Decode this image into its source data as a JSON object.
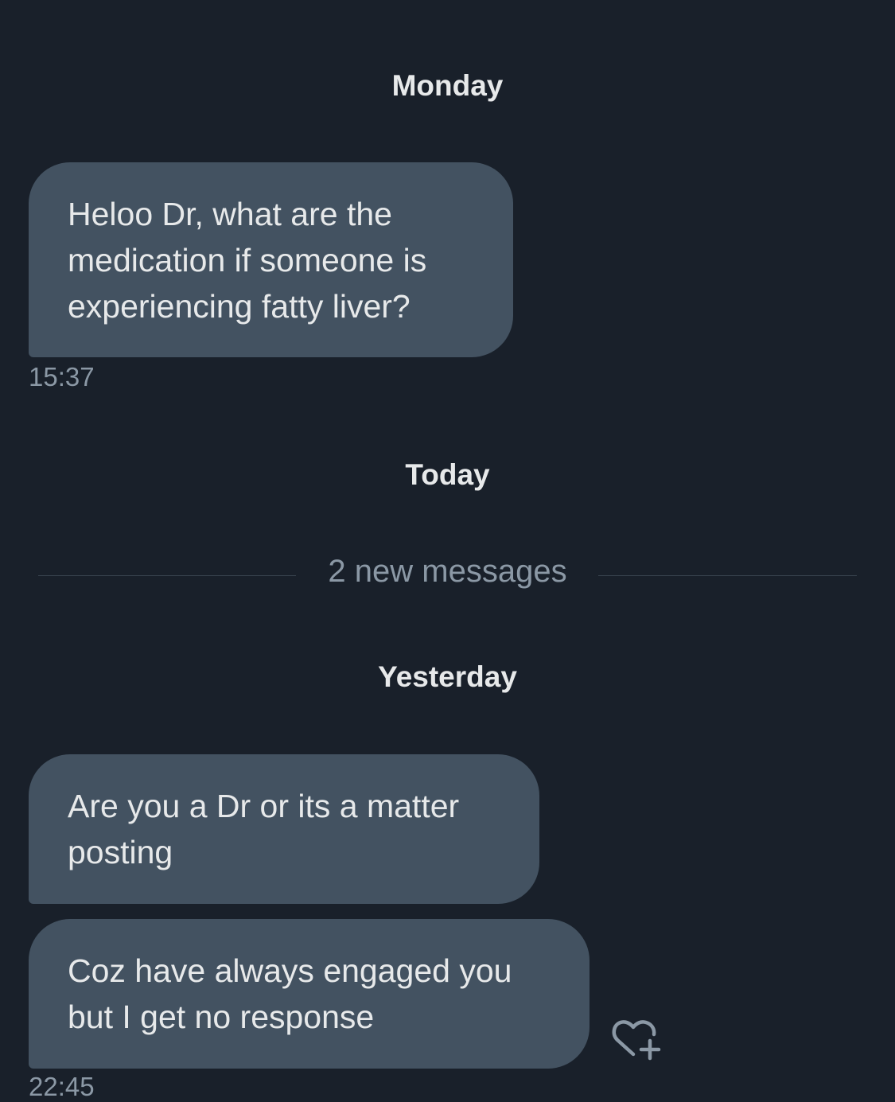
{
  "conversation": {
    "days": {
      "monday": "Monday",
      "today": "Today",
      "yesterday": "Yesterday"
    },
    "new_messages_divider": "2 new messages",
    "messages": [
      {
        "text": "Heloo Dr, what are the medication if someone is experiencing fatty liver?",
        "time": "15:37"
      },
      {
        "text": "Are you a Dr or its a matter posting"
      },
      {
        "text": "Coz have always engaged you but I get no response",
        "time": "22:45"
      }
    ]
  },
  "icons": {
    "reaction": "heart-plus-icon"
  },
  "colors": {
    "background": "#19202a",
    "bubble": "#435261",
    "text": "#e7e9ea",
    "muted": "#8b98a5"
  }
}
